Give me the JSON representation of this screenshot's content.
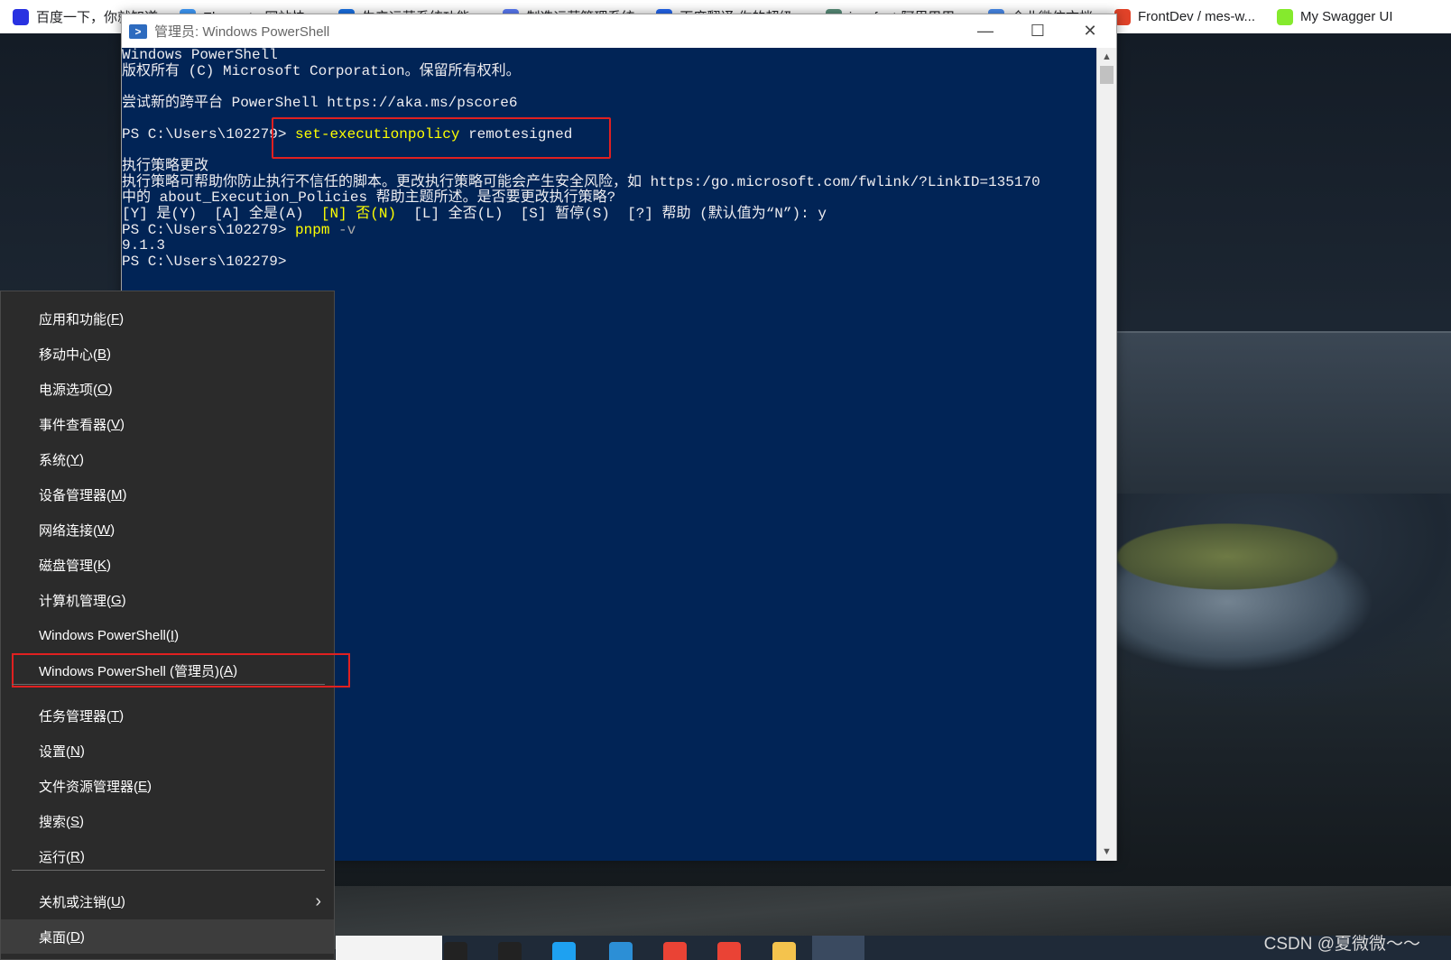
{
  "bookmarks": [
    {
      "label": "百度一下，你就知道",
      "icon": "baidu-paw-icon",
      "color": "#2932e1"
    },
    {
      "label": "Element - 网站快...",
      "icon": "element-icon",
      "color": "#409eff"
    },
    {
      "label": "生产运营系统功能...",
      "icon": "on-icon",
      "color": "#1a73e8"
    },
    {
      "label": "制造运营管理系统",
      "icon": "diamond-icon",
      "color": "#5b7cfa"
    },
    {
      "label": "百度翻译-你的超级...",
      "icon": "translate-icon",
      "color": "#2468f2"
    },
    {
      "label": "iconfont-阿里巴巴...",
      "icon": "iconfont-icon",
      "color": "#5a8f7b"
    },
    {
      "label": "企业微信文档",
      "icon": "search-icon",
      "color": "#4a8df0"
    },
    {
      "label": "FrontDev / mes-w...",
      "icon": "gitlab-fox-icon",
      "color": "#e24329"
    },
    {
      "label": "My Swagger UI",
      "icon": "swagger-icon",
      "color": "#85ea2d"
    }
  ],
  "window": {
    "title": "管理员: Windows PowerShell",
    "minimize": "—",
    "maximize": "☐",
    "close": "✕"
  },
  "console": {
    "line1": "Windows PowerShell",
    "line2": "版权所有 (C) Microsoft Corporation。保留所有权利。",
    "line3": "尝试新的跨平台 PowerShell https://aka.ms/pscore6",
    "prompt1": "PS C:\\Users\\102279> ",
    "cmd1_name": "set-executionpolicy",
    "cmd1_arg": " remotesigned",
    "line4": "执行策略更改",
    "line5": "执行策略可帮助你防止执行不信任的脚本。更改执行策略可能会产生安全风险，如 https:/go.microsoft.com/fwlink/?LinkID=135170",
    "line6": "中的 about_Execution_Policies 帮助主题所述。是否要更改执行策略?",
    "line7_pre": "[Y] 是(Y)  [A] 全是(A)  ",
    "line7_default": "[N] 否(N)",
    "line7_post": "  [L] 全否(L)  [S] 暂停(S)  [?] 帮助 (默认值为“N”): y",
    "prompt2": "PS C:\\Users\\102279> ",
    "cmd2_name": "pnpm",
    "cmd2_arg": " -v",
    "line8": "9.1.3",
    "prompt3": "PS C:\\Users\\102279>"
  },
  "menu": {
    "items": [
      {
        "text": "应用和功能(",
        "key": "F",
        "end": ")"
      },
      {
        "text": "移动中心(",
        "key": "B",
        "end": ")"
      },
      {
        "text": "电源选项(",
        "key": "O",
        "end": ")"
      },
      {
        "text": "事件查看器(",
        "key": "V",
        "end": ")"
      },
      {
        "text": "系统(",
        "key": "Y",
        "end": ")"
      },
      {
        "text": "设备管理器(",
        "key": "M",
        "end": ")"
      },
      {
        "text": "网络连接(",
        "key": "W",
        "end": ")"
      },
      {
        "text": "磁盘管理(",
        "key": "K",
        "end": ")"
      },
      {
        "text": "计算机管理(",
        "key": "G",
        "end": ")"
      },
      {
        "text": "Windows PowerShell(",
        "key": "I",
        "end": ")"
      },
      {
        "text": "Windows PowerShell (管理员)(",
        "key": "A",
        "end": ")"
      },
      {
        "text": "任务管理器(",
        "key": "T",
        "end": ")"
      },
      {
        "text": "设置(",
        "key": "N",
        "end": ")"
      },
      {
        "text": "文件资源管理器(",
        "key": "E",
        "end": ")"
      },
      {
        "text": "搜索(",
        "key": "S",
        "end": ")"
      },
      {
        "text": "运行(",
        "key": "R",
        "end": ")"
      },
      {
        "text": "关机或注销(",
        "key": "U",
        "end": ")"
      },
      {
        "text": "桌面(",
        "key": "D",
        "end": ")"
      }
    ]
  },
  "taskbar": {
    "icons": [
      "search-icon",
      "task-view-icon",
      "edge-icon",
      "vscode-icon",
      "chrome-icon",
      "chrome-icon",
      "file-explorer-icon",
      "powershell-icon"
    ],
    "colors": [
      "#222222",
      "#222222",
      "#1ea1f1",
      "#2c8fd6",
      "#ea4335",
      "#ea4335",
      "#f4c34d",
      "#2d6bbf"
    ]
  },
  "watermark": "CSDN @夏微微～～"
}
